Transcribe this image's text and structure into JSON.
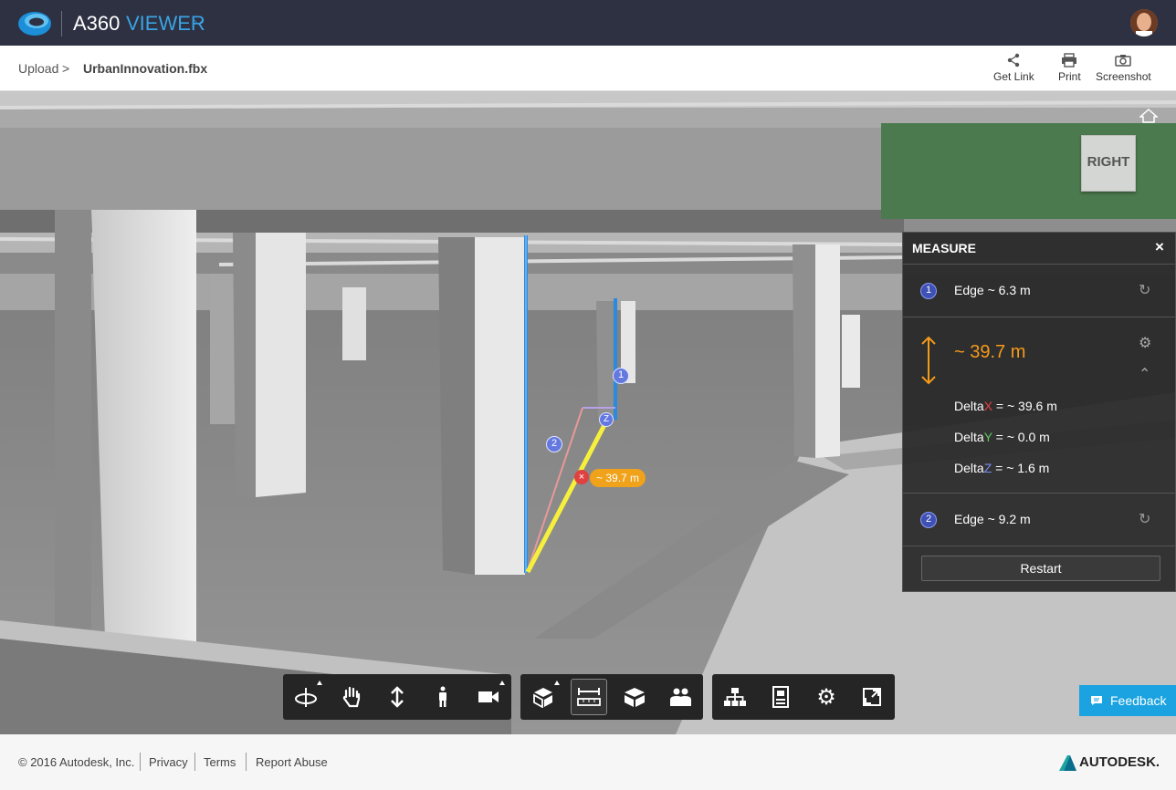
{
  "header": {
    "app_name": "A360",
    "app_sub": "VIEWER",
    "logo_icon": "autodesk-a360-logo",
    "avatar": "user-avatar"
  },
  "breadcrumb": {
    "root": "Upload",
    "separator": ">",
    "file": "UrbanInnovation.fbx"
  },
  "actions": [
    {
      "label": "Get Link",
      "icon": "share-icon"
    },
    {
      "label": "Print",
      "icon": "print-icon"
    },
    {
      "label": "Screenshot",
      "icon": "camera-icon"
    }
  ],
  "viewcube": {
    "face": "RIGHT"
  },
  "scene": {
    "marker1": "1",
    "marker2": "2",
    "marker_z": "Z",
    "distance_label": "~ 39.7 m",
    "x_marker": "×"
  },
  "measure": {
    "title": "MEASURE",
    "close": "×",
    "edge1": {
      "badge": "1",
      "label": "Edge ~ 6.3 m"
    },
    "result": "~ 39.7 m",
    "delta_x": {
      "prefix": "Delta",
      "axis": "X",
      "value": " = ~ 39.6 m"
    },
    "delta_y": {
      "prefix": "Delta",
      "axis": "Y",
      "value": " = ~ 0.0 m"
    },
    "delta_z": {
      "prefix": "Delta",
      "axis": "Z",
      "value": " = ~ 1.6 m"
    },
    "edge2": {
      "badge": "2",
      "label": "Edge ~ 9.2 m"
    },
    "restart": "Restart"
  },
  "toolbar": {
    "navigation": [
      "orbit-icon",
      "pan-icon",
      "zoom-icon",
      "first-person-icon",
      "camera-icon"
    ],
    "modeling": [
      "explode-icon",
      "measure-icon",
      "section-icon",
      "model-browser-icon"
    ],
    "settings": [
      "structure-icon",
      "properties-icon",
      "settings-icon",
      "fullscreen-icon"
    ]
  },
  "feedback": {
    "label": "Feedback"
  },
  "footer": {
    "copyright": "© 2016 Autodesk, Inc.",
    "privacy": "Privacy",
    "terms": "Terms",
    "report": "Report Abuse",
    "brand": "AUTODESK."
  },
  "colors": {
    "topbar": "#2d3142",
    "accent": "#3aa3e3",
    "measure_orange": "#f59b1a",
    "feedback": "#1aa3e0"
  }
}
